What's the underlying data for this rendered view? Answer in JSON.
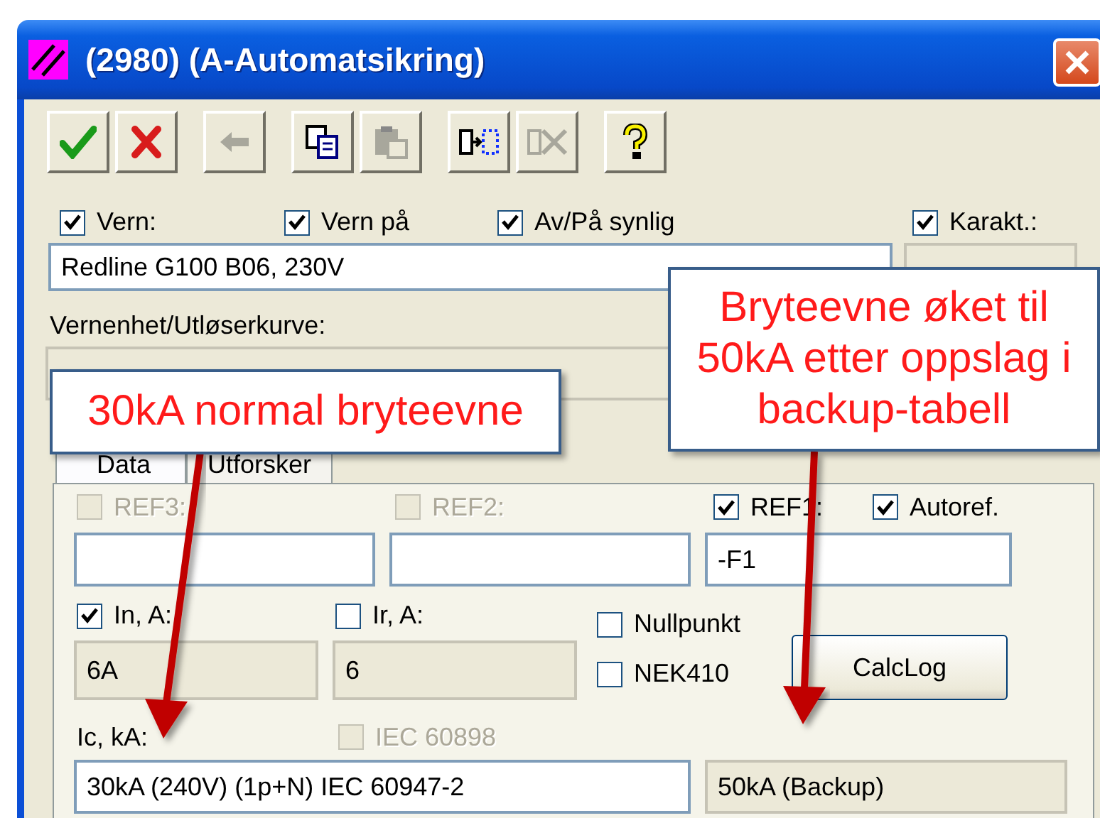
{
  "window": {
    "title": "(2980) (A-Automatsikring)"
  },
  "toolbar": [
    {
      "kind": "ok",
      "disabled": false
    },
    {
      "kind": "cancel",
      "disabled": false
    },
    {
      "kind": "back",
      "disabled": true
    },
    {
      "kind": "copy",
      "disabled": false
    },
    {
      "kind": "paste",
      "disabled": true
    },
    {
      "kind": "insert",
      "disabled": false
    },
    {
      "kind": "remove",
      "disabled": true
    },
    {
      "kind": "help",
      "disabled": false
    }
  ],
  "top_checks": [
    {
      "label": "Vern:",
      "checked": true
    },
    {
      "label": "Vern på",
      "checked": true
    },
    {
      "label": "Av/På synlig",
      "checked": true
    },
    {
      "label": "Karakt.:",
      "checked": true
    }
  ],
  "description": {
    "value": "Redline G100 B06, 230V"
  },
  "curve_label": "Vernenhet/Utløserkurve:",
  "tabs": [
    {
      "label": "Data",
      "selected": true
    },
    {
      "label": "Utforsker",
      "selected": false
    }
  ],
  "refs": [
    {
      "label": "REF3:",
      "checked": false,
      "disabled": true
    },
    {
      "label": "REF2:",
      "checked": false,
      "disabled": true
    },
    {
      "label": "REF1:",
      "checked": true,
      "disabled": false,
      "value": "-F1"
    }
  ],
  "autoref": {
    "label": "Autoref.",
    "checked": true
  },
  "currents": [
    {
      "label": "In, A:",
      "checked": true,
      "value": "6A"
    },
    {
      "label": "Ir, A:",
      "checked": false,
      "value": "6"
    }
  ],
  "options": [
    {
      "label": "Nullpunkt",
      "checked": false
    },
    {
      "label": "NEK410",
      "checked": false
    }
  ],
  "calclog_button": "CalcLog",
  "ic_label": "Ic, kA:",
  "iec_check": {
    "label": "IEC 60898",
    "checked": false,
    "disabled": true
  },
  "ic_value": "30kA (240V) (1p+N) IEC 60947-2",
  "ic_backup": "50kA (Backup)",
  "callouts": [
    {
      "text": "30kA normal bryteevne"
    },
    {
      "text": "Bryteevne øket til 50kA etter oppslag i backup-tabell"
    }
  ]
}
